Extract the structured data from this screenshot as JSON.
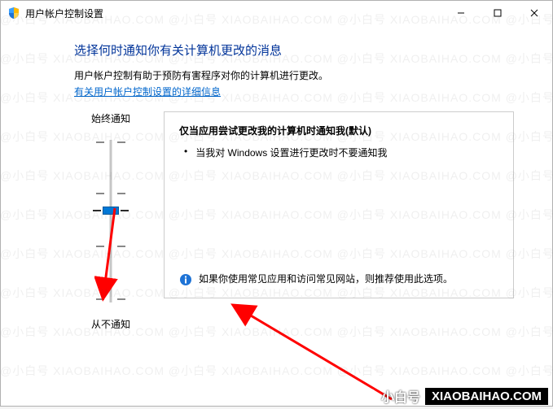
{
  "window": {
    "title": "用户帐户控制设置"
  },
  "heading": "选择何时通知你有关计算机更改的消息",
  "description": "用户帐户控制有助于预防有害程序对你的计算机进行更改。",
  "link": "有关用户帐户控制设置的详细信息",
  "slider": {
    "topLabel": "始终通知",
    "bottomLabel": "从不通知",
    "levels": 4,
    "currentLevel": 2
  },
  "panel": {
    "title": "仅当应用尝试更改我的计算机时通知我(默认)",
    "bullet1": "当我对 Windows 设置进行更改时不要通知我",
    "recommendation": "如果你使用常见应用和访问常见网站，则推荐使用此选项。"
  },
  "watermark": {
    "brandCn": "小白号",
    "url": "XIAOBAIHAO.COM",
    "repeat": "@小白号  XIAOBAIHAO.COM  @小白号  XIAOBAIHAO.COM  @小白号  XIAOBAIHAO.COM  @小白号  XIAOBAIHAO.COM"
  }
}
